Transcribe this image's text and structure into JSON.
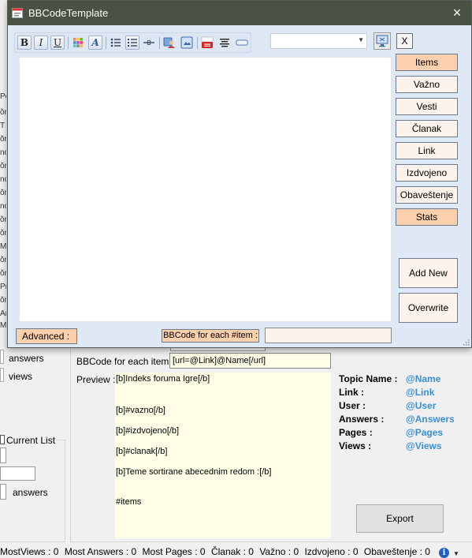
{
  "dialog": {
    "title": "BBCodeTemplate",
    "close_glyph": "×",
    "x_button_label": "X",
    "combo_value": "",
    "toolbar_icons": [
      "bold-icon",
      "italic-icon",
      "underline-icon",
      "color-icon",
      "font-icon",
      "bulleted-list-icon",
      "numbered-list-icon",
      "horizontal-rule-icon",
      "user-icon",
      "image-icon",
      "youtube-icon",
      "align-center-icon",
      "spoiler-icon"
    ],
    "toolbar_text": {
      "bold": "B",
      "italic": "I",
      "underline": "U",
      "font": "A",
      "youtube": "You"
    },
    "editor_text": "",
    "side_buttons": [
      {
        "label": "Items",
        "active": true
      },
      {
        "label": "Važno",
        "active": false
      },
      {
        "label": "Vesti",
        "active": false
      },
      {
        "label": "Članak",
        "active": false
      },
      {
        "label": "Link",
        "active": false
      },
      {
        "label": "Izdvojeno",
        "active": false
      },
      {
        "label": "Obaveštenje",
        "active": false
      },
      {
        "label": "Stats",
        "active": true
      }
    ],
    "add_new_label": "Add New",
    "overwrite_label": "Overwrite",
    "advanced_label": "Advanced :",
    "bbcode_each_label": "BBCode for each #item :",
    "bbcode_each_value": ""
  },
  "background": {
    "edge_letters": [
      "Po",
      "ŏr",
      "T",
      "ŏr",
      "no",
      "ŏr",
      "no",
      "ŏr",
      "no",
      "ŏr",
      "ŏr",
      "M",
      "ŏr",
      "ŏr",
      "Pr",
      "ŏr",
      "Ar",
      "M"
    ],
    "answers_label": "answers",
    "views_label": "views",
    "current_list_label": "Current List",
    "answers_label_2": "answers",
    "bbcode_each_label": "BBCode for each item :",
    "bbcode_each_value": "[url=@Link]@Name[/url]",
    "preview_label": "Preview :",
    "preview_lines": [
      "[b]Indeks foruma Igre[/b]",
      "[b]#vazno[/b]",
      "[b]#izdvojeno[/b]",
      "[b]#clanak[/b]",
      "[b]Teme sortirane abecednim redom :[/b]",
      "#items"
    ],
    "legend": [
      {
        "key": "Topic Name :",
        "value": "@Name"
      },
      {
        "key": "Link :",
        "value": "@Link"
      },
      {
        "key": "User :",
        "value": "@User"
      },
      {
        "key": "Answers :",
        "value": "@Answers"
      },
      {
        "key": "Pages :",
        "value": "@Pages"
      },
      {
        "key": "Views :",
        "value": "@Views"
      }
    ],
    "export_label": "Export",
    "accent_color": "#3b8fd8"
  },
  "statusbar": {
    "items": [
      "MostViews : 0",
      "Most Answers : 0",
      "Most Pages : 0",
      "Članak : 0",
      "Važno : 0",
      "Izdvojeno : 0",
      "Obaveštenje : 0"
    ],
    "info_icon": "info-icon",
    "info_glyph": "i",
    "dropdown_glyph": "▼"
  }
}
